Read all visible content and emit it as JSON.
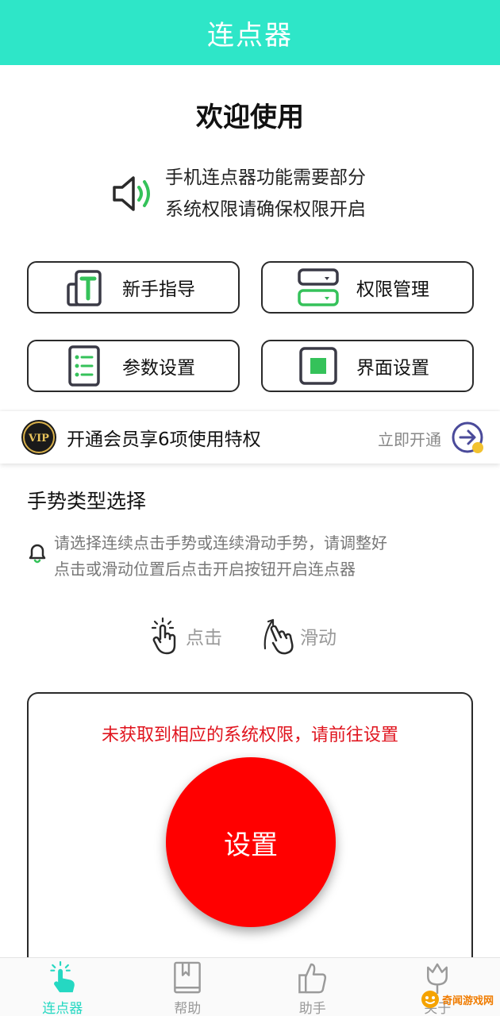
{
  "app_bar": {
    "title": "连点器"
  },
  "welcome": "欢迎使用",
  "notice": {
    "line1": "手机连点器功能需要部分",
    "line2": "系统权限请确保权限开启"
  },
  "features": [
    {
      "label": "新手指导",
      "icon": "guide-icon"
    },
    {
      "label": "权限管理",
      "icon": "permission-icon"
    },
    {
      "label": "参数设置",
      "icon": "list-settings-icon"
    },
    {
      "label": "界面设置",
      "icon": "interface-icon"
    }
  ],
  "vip": {
    "text": "开通会员享6项使用特权",
    "action": "立即开通",
    "badge": "VIP"
  },
  "gesture_section": {
    "title": "手势类型选择",
    "hint_line1": "请选择连续点击手势或连续滑动手势，请调整好",
    "hint_line2": "点击或滑动位置后点击开启按钮开启连点器",
    "options": [
      {
        "label": "点击",
        "icon": "tap-hand-icon"
      },
      {
        "label": "滑动",
        "icon": "swipe-hand-icon"
      }
    ]
  },
  "panel": {
    "message": "未获取到相应的系统权限，请前往设置",
    "button_label": "设置"
  },
  "bottom_nav": [
    {
      "label": "连点器",
      "active": true
    },
    {
      "label": "帮助",
      "active": false
    },
    {
      "label": "助手",
      "active": false
    },
    {
      "label": "关于",
      "active": false
    }
  ],
  "watermark": {
    "text": "奇闻游戏网"
  },
  "colors": {
    "accent": "#2ee6c8",
    "green": "#35c25a",
    "red": "#ff0000",
    "warn_text": "#e0141e",
    "nav_active": "#25d8c2"
  }
}
